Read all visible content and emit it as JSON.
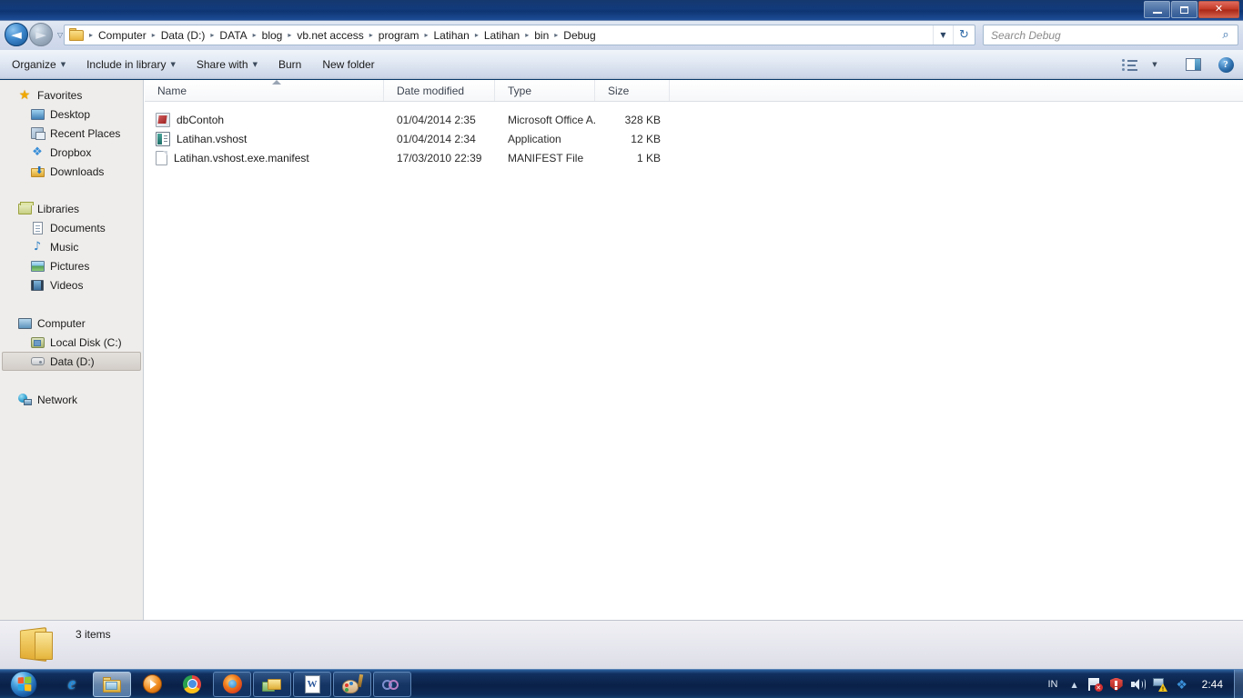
{
  "window": {
    "minimize_label": "Minimize",
    "maximize_label": "Maximize",
    "close_label": "✕"
  },
  "address": {
    "folder_icon": "folder-icon",
    "separator": "▸",
    "crumbs": [
      "Computer",
      "Data (D:)",
      "DATA",
      "blog",
      "vb.net access",
      "program",
      "Latihan",
      "Latihan",
      "bin",
      "Debug"
    ],
    "dropdown_caret": "▼",
    "refresh_icon": "↻",
    "back_glyph": "◄",
    "forward_glyph": "►",
    "history_caret": "▽"
  },
  "search": {
    "placeholder": "Search Debug",
    "value": "",
    "icon": "search-icon"
  },
  "toolbar": {
    "items": [
      {
        "label": "Organize",
        "has_caret": true
      },
      {
        "label": "Include in library",
        "has_caret": true
      },
      {
        "label": "Share with",
        "has_caret": true
      },
      {
        "label": "Burn",
        "has_caret": false
      },
      {
        "label": "New folder",
        "has_caret": false
      }
    ],
    "view_caret": "▼",
    "help_glyph": "?"
  },
  "sidebar": {
    "groups": [
      {
        "header": {
          "label": "Favorites",
          "icon": "star-icon"
        },
        "items": [
          {
            "label": "Desktop",
            "icon": "desktop-icon"
          },
          {
            "label": "Recent Places",
            "icon": "recent-places-icon"
          },
          {
            "label": "Dropbox",
            "icon": "dropbox-icon"
          },
          {
            "label": "Downloads",
            "icon": "downloads-icon"
          }
        ]
      },
      {
        "header": {
          "label": "Libraries",
          "icon": "libraries-icon"
        },
        "items": [
          {
            "label": "Documents",
            "icon": "documents-icon"
          },
          {
            "label": "Music",
            "icon": "music-icon"
          },
          {
            "label": "Pictures",
            "icon": "pictures-icon"
          },
          {
            "label": "Videos",
            "icon": "videos-icon"
          }
        ]
      },
      {
        "header": {
          "label": "Computer",
          "icon": "computer-icon"
        },
        "items": [
          {
            "label": "Local Disk (C:)",
            "icon": "local-disk-icon",
            "selected": false
          },
          {
            "label": "Data (D:)",
            "icon": "drive-icon",
            "selected": true
          }
        ]
      },
      {
        "header": {
          "label": "Network",
          "icon": "network-icon"
        },
        "items": []
      }
    ]
  },
  "filelist": {
    "columns": [
      "Name",
      "Date modified",
      "Type",
      "Size"
    ],
    "sort_column": "Name",
    "sort_direction": "ascending",
    "rows": [
      {
        "name": "dbContoh",
        "date_modified": "01/04/2014 2:35",
        "type": "Microsoft Office A...",
        "size": "328 KB",
        "icon": "access-database-icon"
      },
      {
        "name": "Latihan.vshost",
        "date_modified": "01/04/2014 2:34",
        "type": "Application",
        "size": "12 KB",
        "icon": "application-icon"
      },
      {
        "name": "Latihan.vshost.exe.manifest",
        "date_modified": "17/03/2010 22:39",
        "type": "MANIFEST File",
        "size": "1 KB",
        "icon": "blank-document-icon"
      }
    ]
  },
  "status": {
    "text": "3 items",
    "folder_icon": "folder-icon"
  },
  "taskbar": {
    "start_label": "Start",
    "buttons": [
      {
        "name": "internet-explorer",
        "icon": "ie-icon",
        "state": "normal"
      },
      {
        "name": "windows-explorer",
        "icon": "explorer-icon",
        "state": "active"
      },
      {
        "name": "windows-media-player",
        "icon": "wmp-icon",
        "state": "normal"
      },
      {
        "name": "google-chrome",
        "icon": "chrome-icon",
        "state": "normal"
      },
      {
        "name": "mozilla-firefox",
        "icon": "firefox-icon",
        "state": "grouped"
      },
      {
        "name": "folders-app",
        "icon": "folders-icon",
        "state": "grouped"
      },
      {
        "name": "microsoft-word",
        "icon": "word-icon",
        "state": "grouped"
      },
      {
        "name": "paint-app",
        "icon": "paint-icon",
        "state": "grouped"
      },
      {
        "name": "rings-app",
        "icon": "rings-icon",
        "state": "grouped"
      }
    ],
    "tray": {
      "language": "IN",
      "chevron": "▲",
      "icons": [
        {
          "name": "action-center-icon"
        },
        {
          "name": "security-shield-icon"
        },
        {
          "name": "volume-icon"
        },
        {
          "name": "network-warning-icon"
        },
        {
          "name": "dropbox-tray-icon"
        }
      ],
      "clock": "2:44"
    }
  },
  "colors": {
    "titlebar": "#123b7c",
    "taskbar": "#0a2147",
    "sidebar_bg": "#efedeb",
    "filepane_bg": "#ffffff",
    "accent": "#2f6ba8",
    "close_button": "#c33a26"
  }
}
